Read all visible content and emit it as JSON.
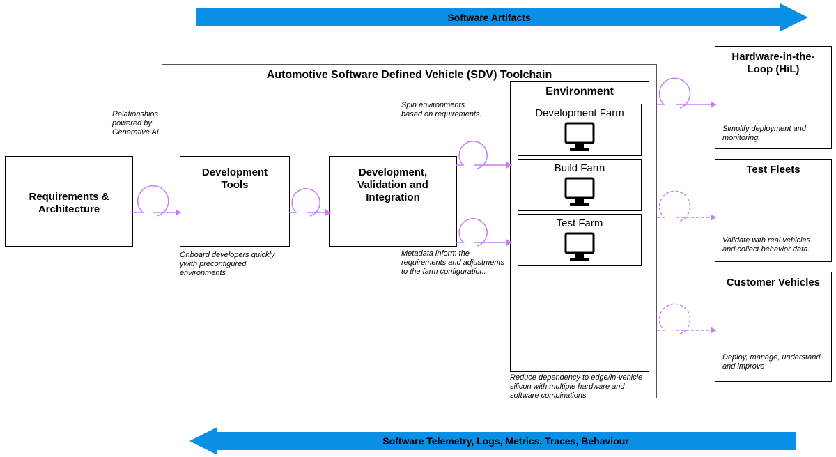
{
  "top_arrow": {
    "label": "Software Artifacts"
  },
  "bottom_arrow": {
    "label": "Software Telemetry, Logs, Metrics, Traces, Behaviour"
  },
  "toolchain": {
    "title": "Automotive Software Defined Vehicle (SDV) Toolchain"
  },
  "left_box": {
    "title": "Requirements &\nArchitecture"
  },
  "dev_tools": {
    "title": "Development\nTools",
    "note": "Onboard developers quickly ywith preconfigured environments"
  },
  "dvi": {
    "title": "Development,\nValidation and\nIntegration"
  },
  "env": {
    "title": "Environment",
    "farms": [
      "Development Farm",
      "Build Farm",
      "Test Farm"
    ],
    "note": "Reduce dependency to edge/in-vehicle silicon with multiple hardware and software combinations."
  },
  "notes": {
    "relationships": "Relationshios powered by Generative AI",
    "spin": "Spin environments based on requirements.",
    "metadata": "Metadata inform the requirements and adjustments to the farm configuration."
  },
  "right": {
    "hil": {
      "title": "Hardware-in-the-\nLoop (HiL)",
      "note": "Simplify deployment and monitoring."
    },
    "fleets": {
      "title": "Test Fleets",
      "note": "Validate with real vehicles and collect behavior data."
    },
    "customers": {
      "title": "Customer Vehicles",
      "note": "Deploy, manage, understand and improve"
    }
  }
}
